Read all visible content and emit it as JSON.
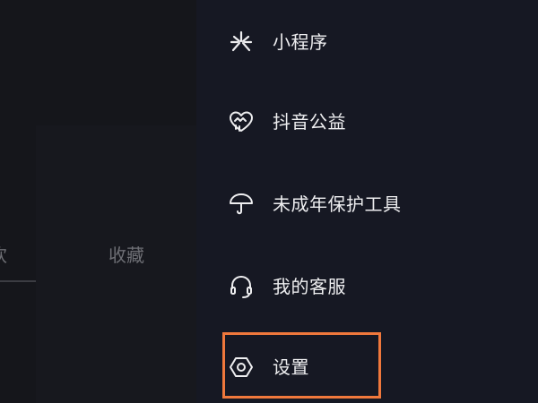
{
  "background_tabs": {
    "left_partial": "欢",
    "favorites": "收藏"
  },
  "menu": {
    "items": [
      {
        "id": "mini-programs",
        "label": "小程序",
        "icon": "asterisk-icon"
      },
      {
        "id": "charity",
        "label": "抖音公益",
        "icon": "heart-icon"
      },
      {
        "id": "minor-protection",
        "label": "未成年保护工具",
        "icon": "umbrella-icon"
      },
      {
        "id": "customer-service",
        "label": "我的客服",
        "icon": "headset-icon"
      },
      {
        "id": "settings",
        "label": "设置",
        "icon": "hexagon-gear-icon"
      }
    ]
  },
  "colors": {
    "drawer_bg": "#161823",
    "text": "#eeeef0",
    "highlight_border": "#f0783c"
  }
}
